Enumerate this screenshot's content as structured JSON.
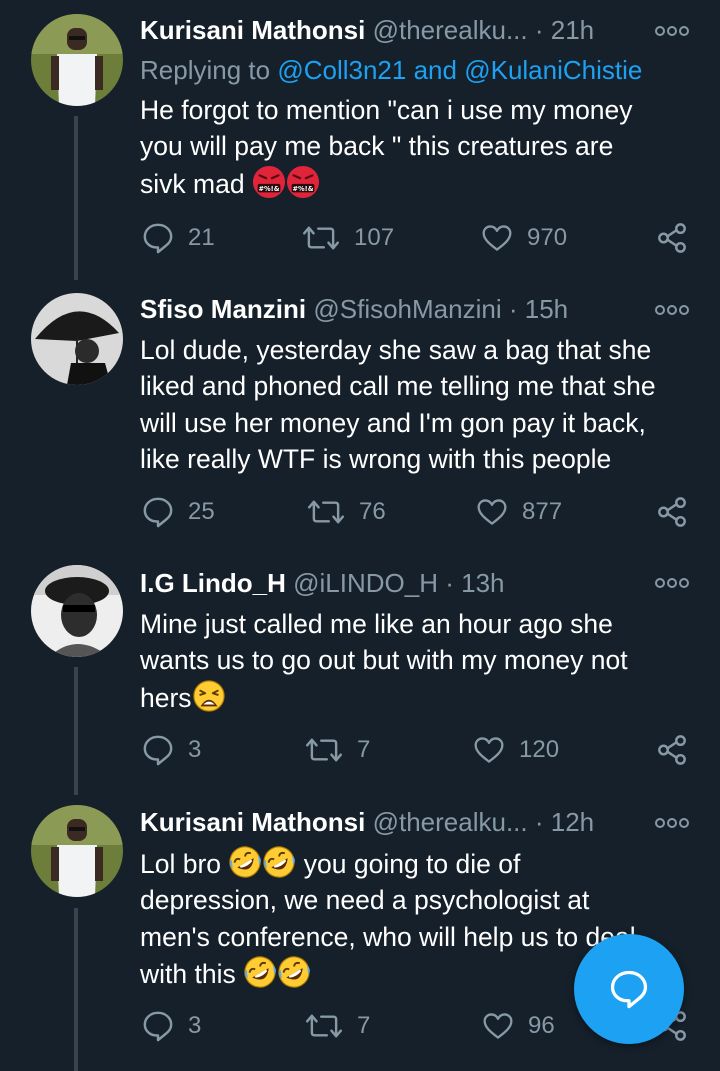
{
  "tweets": [
    {
      "name": "Kurisani Mathonsi",
      "handle": "@therealku...",
      "time": "21h",
      "separator": "·",
      "reply_prefix": "Replying to",
      "reply_handle_1": "@Coll3n21",
      "reply_and": "and",
      "reply_handle_2": "@KulaniChistie",
      "text_line1": "He forgot to mention \"can i use my money",
      "text_line2": "you will pay me back \" this creatures are",
      "text_line3": "sivk mad",
      "text_emoji": "angry-cursing-face x2",
      "replies": "21",
      "retweets": "107",
      "likes": "970"
    },
    {
      "name": "Sfiso Manzini",
      "handle": "@SfisohManzini",
      "time": "15h",
      "separator": "·",
      "text_line1": "Lol dude, yesterday she saw a bag that she",
      "text_line2": "liked and phoned call me telling me that she",
      "text_line3": "will use her money and I'm gon pay it back,",
      "text_line4": "like really WTF is wrong with this people",
      "replies": "25",
      "retweets": "76",
      "likes": "877"
    },
    {
      "name": "I.G Lindo_H",
      "handle": "@iLINDO_H",
      "time": "13h",
      "separator": "·",
      "text_line1": "Mine just called me like an hour ago she",
      "text_line2": "wants us to go out but with my money not",
      "text_line3": "hers",
      "text_emoji": "weary-face",
      "replies": "3",
      "retweets": "7",
      "likes": "120"
    },
    {
      "name": "Kurisani Mathonsi",
      "handle": "@therealku...",
      "time": "12h",
      "separator": "·",
      "text_line1_a": "Lol bro",
      "text_line1_b": " you going to die of",
      "text_line2": "depression, we need a psychologist at",
      "text_line3": "men's conference, who will help us to deal",
      "text_line4": "with this",
      "text_emoji": "rolling-on-floor-laughing x2",
      "replies": "3",
      "retweets": "7",
      "likes": "96"
    }
  ],
  "colors": {
    "background": "#15202b",
    "primary_text": "#ffffff",
    "secondary_text": "#8899a6",
    "accent": "#1da1f2",
    "thread_line": "#38444d"
  },
  "icons": [
    "more-icon",
    "reply-icon",
    "retweet-icon",
    "like-icon",
    "share-icon",
    "compose-reply-icon"
  ]
}
